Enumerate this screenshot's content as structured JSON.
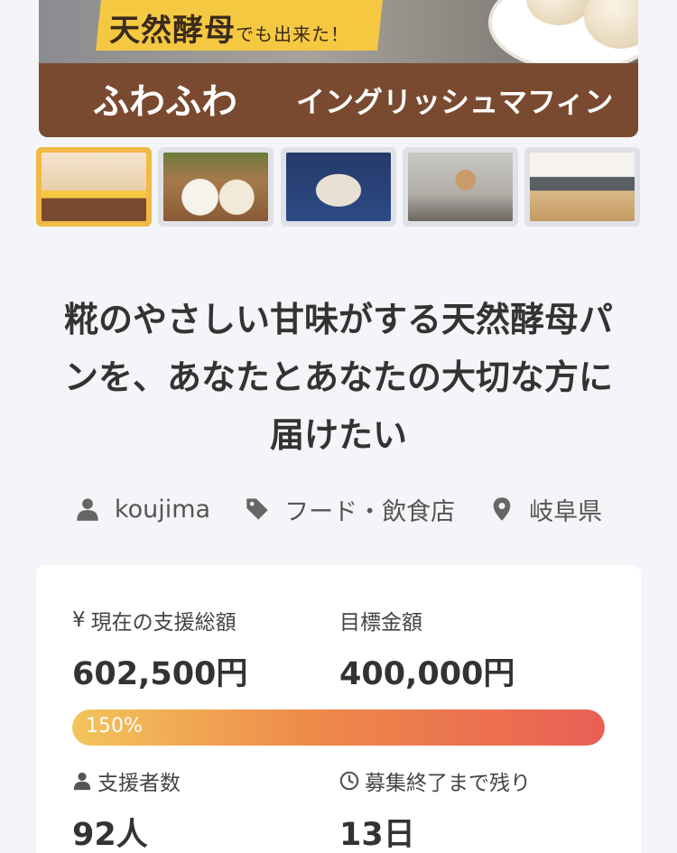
{
  "hero": {
    "catch_main": "天然酵母",
    "catch_small": "でも出来た！",
    "fuwa": "ふわふわ",
    "muffin": "イングリッシュマフィン"
  },
  "thumbnails": [
    {
      "name": "thumb-1",
      "active": true
    },
    {
      "name": "thumb-2",
      "active": false
    },
    {
      "name": "thumb-3",
      "active": false
    },
    {
      "name": "thumb-4",
      "active": false
    },
    {
      "name": "thumb-5",
      "active": false
    }
  ],
  "project": {
    "title_line1": "糀のやさしい甘味がする天然酵母パ",
    "title_line2": "ンを、あなたとあなたの大切な方に",
    "title_line3": "届けたい",
    "author": "koujima",
    "category": "フード・飲食店",
    "location": "岐阜県"
  },
  "stats": {
    "current_label": "現在の支援総額",
    "currency_symbol": "¥",
    "current_value": "602,500円",
    "goal_label": "目標金額",
    "goal_value": "400,000円",
    "progress_text": "150%",
    "progress_percent": 150,
    "supporters_label": "支援者数",
    "supporters_value": "92人",
    "remaining_label": "募集終了まで残り",
    "remaining_value": "13日"
  },
  "icons": {
    "author": "user-icon",
    "category": "tag-icon",
    "location": "map-pin-icon",
    "supporters": "user-icon",
    "remaining": "clock-icon"
  },
  "colors": {
    "progress_start": "#f3c45b",
    "progress_end": "#ea5f55",
    "active_thumb_border": "#f1b945"
  }
}
